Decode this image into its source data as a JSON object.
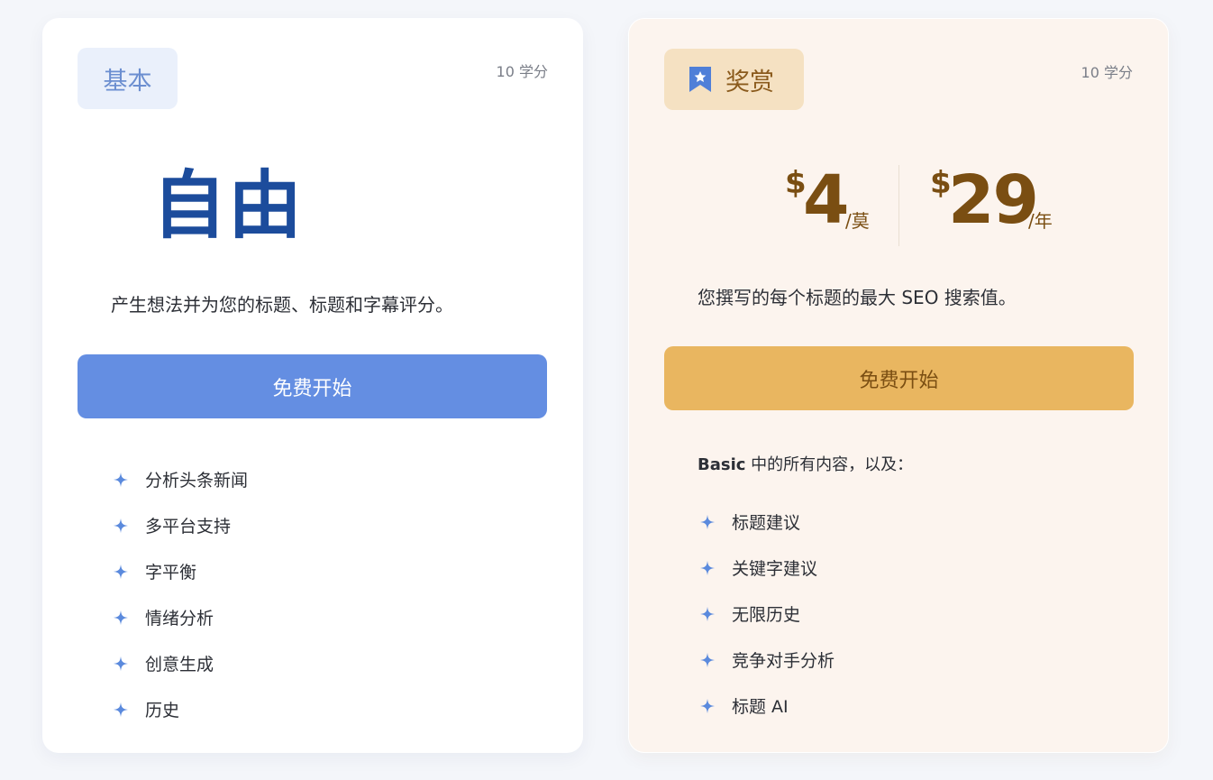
{
  "colors": {
    "page_bg": "#f4f6fa",
    "basic_card_bg": "#ffffff",
    "premium_card_bg": "#fcf4ee",
    "basic_accent": "#648ee2",
    "basic_title": "#1c4c9c",
    "premium_accent": "#e9b660",
    "premium_text": "#7a4e12",
    "spark_icon": "#5b8add"
  },
  "basic": {
    "badge_label": "基本",
    "credits": "10 学分",
    "title": "自由",
    "description": "产生想法并为您的标题、标题和字幕评分。",
    "cta_label": "免费开始",
    "features": [
      {
        "label": "分析头条新闻",
        "icon": "sparkle-icon"
      },
      {
        "label": "多平台支持",
        "icon": "sparkle-icon"
      },
      {
        "label": "字平衡",
        "icon": "sparkle-icon"
      },
      {
        "label": "情绪分析",
        "icon": "sparkle-icon"
      },
      {
        "label": "创意生成",
        "icon": "sparkle-icon"
      },
      {
        "label": "历史",
        "icon": "sparkle-icon"
      }
    ]
  },
  "premium": {
    "badge_icon": "bookmark-star-icon",
    "badge_label": "奖赏",
    "credits": "10 学分",
    "monthly": {
      "currency": "$",
      "amount": "4",
      "period": "/莫"
    },
    "yearly": {
      "currency": "$",
      "amount": "29",
      "period": "/年"
    },
    "description": "您撰写的每个标题的最大 SEO 搜索值。",
    "cta_label": "免费开始",
    "includes_bold": "Basic",
    "includes_rest": " 中的所有内容，以及：",
    "features": [
      {
        "label": "标题建议",
        "icon": "sparkle-icon"
      },
      {
        "label": "关键字建议",
        "icon": "sparkle-icon"
      },
      {
        "label": "无限历史",
        "icon": "sparkle-icon"
      },
      {
        "label": "竞争对手分析",
        "icon": "sparkle-icon"
      },
      {
        "label": "标题 AI",
        "icon": "sparkle-icon"
      }
    ]
  }
}
